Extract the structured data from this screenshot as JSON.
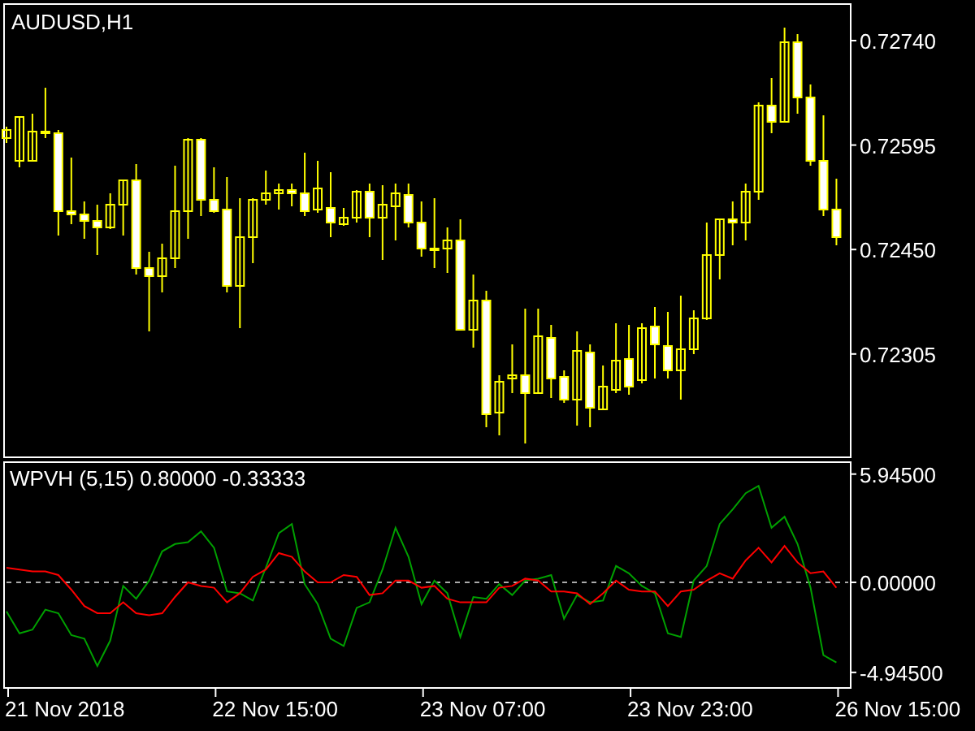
{
  "price_chart": {
    "title": "AUDUSD,H1",
    "price_labels": [
      "0.72740",
      "0.72595",
      "0.72450",
      "0.72305"
    ]
  },
  "indicator": {
    "chart_data": {
      "type": "line",
      "title": "WPVH (5,15) 0.80000 -0.33333",
      "ylim": [
        -5.8,
        6.6
      ],
      "yticks": [
        {
          "value": 5.945,
          "label": "5.94500"
        },
        {
          "value": 0,
          "label": "0.00000"
        },
        {
          "value": -4.945,
          "label": "-4.94500"
        }
      ],
      "series": [
        {
          "color": "#00a000",
          "values": [
            -1.6,
            -2.8,
            -2.6,
            -1.5,
            -1.7,
            -2.9,
            -3.1,
            -4.6,
            -3.2,
            -0.2,
            -0.9,
            0.1,
            1.7,
            2.1,
            2.2,
            2.8,
            1.9,
            -0.5,
            -0.6,
            -1.0,
            0.8,
            2.7,
            3.2,
            -0.1,
            -1.2,
            -3.1,
            -3.5,
            -1.4,
            -1.1,
            0.7,
            3.0,
            1.4,
            -1.2,
            0.1,
            -0.6,
            -3.0,
            -0.8,
            -0.9,
            -0.1,
            -0.7,
            0.1,
            0.2,
            0.4,
            -2.0,
            -0.7,
            -1.1,
            -1.0,
            0.9,
            0.5,
            -0.2,
            -0.6,
            -2.8,
            -3.0,
            0.1,
            0.9,
            3.2,
            4.0,
            4.9,
            5.3,
            3.0,
            3.6,
            2.1,
            -0.3,
            -4.0,
            -4.4
          ]
        },
        {
          "color": "#ff0000",
          "values": [
            0.8,
            0.7,
            0.6,
            0.6,
            0.4,
            -0.4,
            -1.3,
            -1.7,
            -1.7,
            -1.1,
            -1.7,
            -1.8,
            -1.7,
            -0.8,
            0.0,
            -0.2,
            -0.3,
            -1.1,
            -0.6,
            0.3,
            0.7,
            1.6,
            1.4,
            0.6,
            0.0,
            0.0,
            0.4,
            0.3,
            -0.7,
            -0.6,
            0.1,
            0.1,
            -0.3,
            -0.2,
            -0.9,
            -1.1,
            -1.1,
            -1.1,
            -0.3,
            -0.2,
            0.2,
            0.1,
            -0.5,
            -0.5,
            -0.6,
            -1.2,
            -0.6,
            0.1,
            -0.4,
            -0.5,
            -0.5,
            -1.3,
            -0.5,
            -0.4,
            0.1,
            0.5,
            0.2,
            1.2,
            1.9,
            1.1,
            2.0,
            1.1,
            0.5,
            0.6,
            -0.3
          ]
        }
      ]
    },
    "time_labels": [
      "21 Nov 2018",
      "22 Nov 15:00",
      "23 Nov 07:00",
      "23 Nov 23:00",
      "26 Nov 15:00"
    ]
  }
}
